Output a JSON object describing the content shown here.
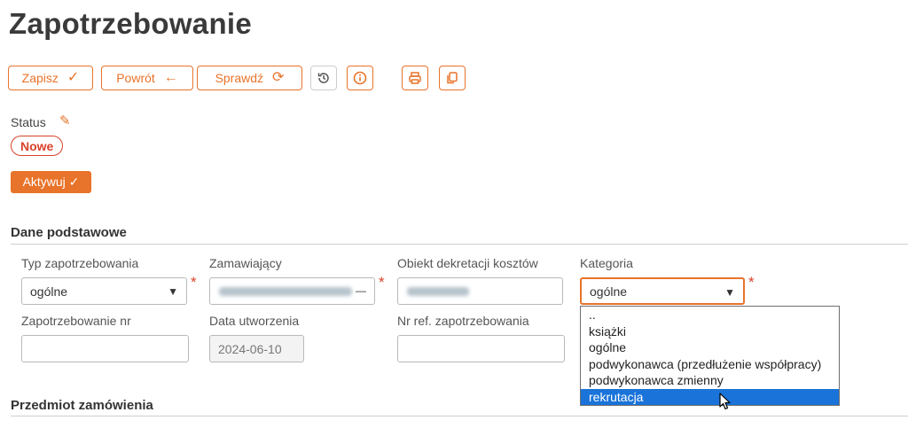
{
  "page": {
    "title": "Zapotrzebowanie"
  },
  "toolbar": {
    "save_label": "Zapisz",
    "back_label": "Powrót",
    "check_label": "Sprawdź"
  },
  "status": {
    "label": "Status",
    "value": "Nowe"
  },
  "activate_label": "Aktywuj ✓",
  "basic": {
    "section_title": "Dane podstawowe",
    "type_label": "Typ zapotrzebowania",
    "type_value": "ogólne",
    "orderer_label": "Zamawiający",
    "cost_label": "Obiekt dekretacji kosztów",
    "category_label": "Kategoria",
    "category_value": "ogólne",
    "number_label": "Zapotrzebowanie nr",
    "number_value": "",
    "created_label": "Data utworzenia",
    "created_value": "2024-06-10",
    "ref_label": "Nr ref. zapotrzebowania",
    "ref_value": ""
  },
  "category_options": [
    "..",
    "książki",
    "ogólne",
    "podwykonawca (przedłużenie współpracy)",
    "podwykonawca zmienny",
    "rekrutacja"
  ],
  "items_section_title": "Przedmiot zamówienia",
  "colors": {
    "accent": "#e8732a",
    "status": "#d9432a",
    "highlight": "#1a73d9"
  }
}
